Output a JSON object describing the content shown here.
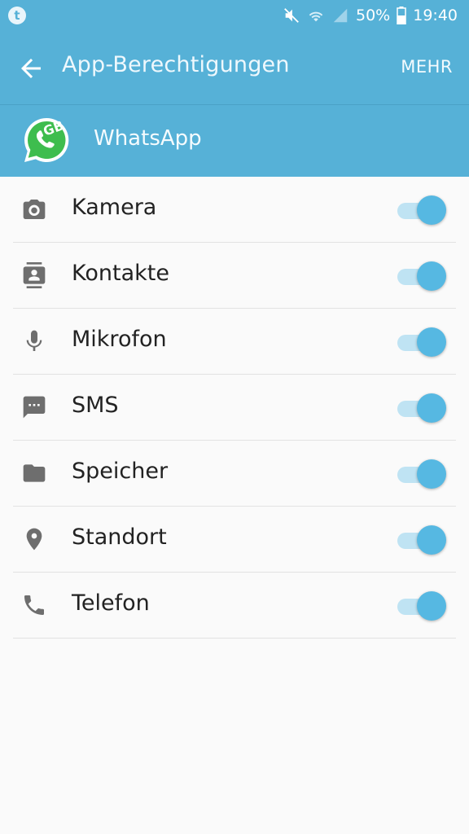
{
  "status_bar": {
    "battery": "50%",
    "time": "19:40"
  },
  "toolbar": {
    "title": "App-Berechtigungen",
    "more_label": "MEHR"
  },
  "app": {
    "name": "WhatsApp",
    "badge": "GB"
  },
  "permissions": [
    {
      "label": "Kamera",
      "icon": "camera-icon",
      "enabled": true
    },
    {
      "label": "Kontakte",
      "icon": "contacts-icon",
      "enabled": true
    },
    {
      "label": "Mikrofon",
      "icon": "microphone-icon",
      "enabled": true
    },
    {
      "label": "SMS",
      "icon": "sms-icon",
      "enabled": true
    },
    {
      "label": "Speicher",
      "icon": "folder-icon",
      "enabled": true
    },
    {
      "label": "Standort",
      "icon": "location-icon",
      "enabled": true
    },
    {
      "label": "Telefon",
      "icon": "phone-icon",
      "enabled": true
    }
  ],
  "colors": {
    "accent": "#56b1d7",
    "toggle_on": "#56b8e2",
    "toggle_track": "#bfe3f3",
    "whatsapp_green": "#3ebd4e"
  }
}
